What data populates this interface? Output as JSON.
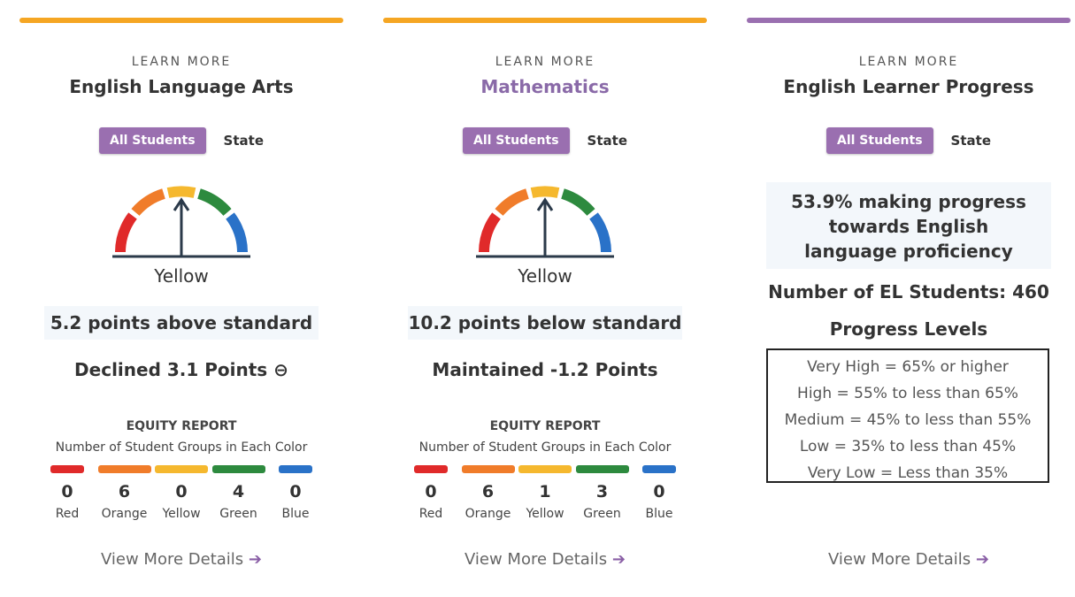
{
  "cards": [
    {
      "accent": "#f5a623",
      "learn_more": "LEARN MORE",
      "title": "English Language Arts",
      "title_color": "#333333",
      "toggle_all": "All Students",
      "toggle_state": "State",
      "gauge_color": "Yellow",
      "status": "5.2 points above standard",
      "change": "Declined 3.1 Points ⊖",
      "equity_title": "EQUITY REPORT",
      "equity_subtitle": "Number of Student Groups in Each Color",
      "groups": [
        {
          "name": "Red",
          "count": "0",
          "color": "#e02a2a"
        },
        {
          "name": "Orange",
          "count": "6",
          "color": "#f07c2a"
        },
        {
          "name": "Yellow",
          "count": "0",
          "color": "#f5b82e"
        },
        {
          "name": "Green",
          "count": "4",
          "color": "#2d8a3e"
        },
        {
          "name": "Blue",
          "count": "0",
          "color": "#2a72c8"
        }
      ],
      "view_more": "View More Details"
    },
    {
      "accent": "#f5a623",
      "learn_more": "LEARN MORE",
      "title": "Mathematics",
      "title_color": "#8a6aa8",
      "toggle_all": "All Students",
      "toggle_state": "State",
      "gauge_color": "Yellow",
      "status": "10.2 points below standard",
      "change": "Maintained -1.2 Points",
      "equity_title": "EQUITY REPORT",
      "equity_subtitle": "Number of Student Groups in Each Color",
      "groups": [
        {
          "name": "Red",
          "count": "0",
          "color": "#e02a2a"
        },
        {
          "name": "Orange",
          "count": "6",
          "color": "#f07c2a"
        },
        {
          "name": "Yellow",
          "count": "1",
          "color": "#f5b82e"
        },
        {
          "name": "Green",
          "count": "3",
          "color": "#2d8a3e"
        },
        {
          "name": "Blue",
          "count": "0",
          "color": "#2a72c8"
        }
      ],
      "view_more": "View More Details"
    },
    {
      "accent": "#9a6fb0",
      "learn_more": "LEARN MORE",
      "title": "English Learner Progress",
      "title_color": "#333333",
      "toggle_all": "All Students",
      "toggle_state": "State",
      "progress_message": "53.9% making progress towards English language proficiency",
      "el_count_text": "Number of EL Students: 460",
      "levels_title": "Progress Levels",
      "levels": [
        "Very High = 65% or higher",
        "High = 55% to less than 65%",
        "Medium = 45% to less than 55%",
        "Low = 35% to less than 45%",
        "Very Low = Less than 35%"
      ],
      "view_more": "View More Details"
    }
  ],
  "gauge_segment_colors": [
    "#e02a2a",
    "#f07c2a",
    "#f5b82e",
    "#2d8a3e",
    "#2a72c8"
  ],
  "arrow_icon": "arrow-right-icon"
}
